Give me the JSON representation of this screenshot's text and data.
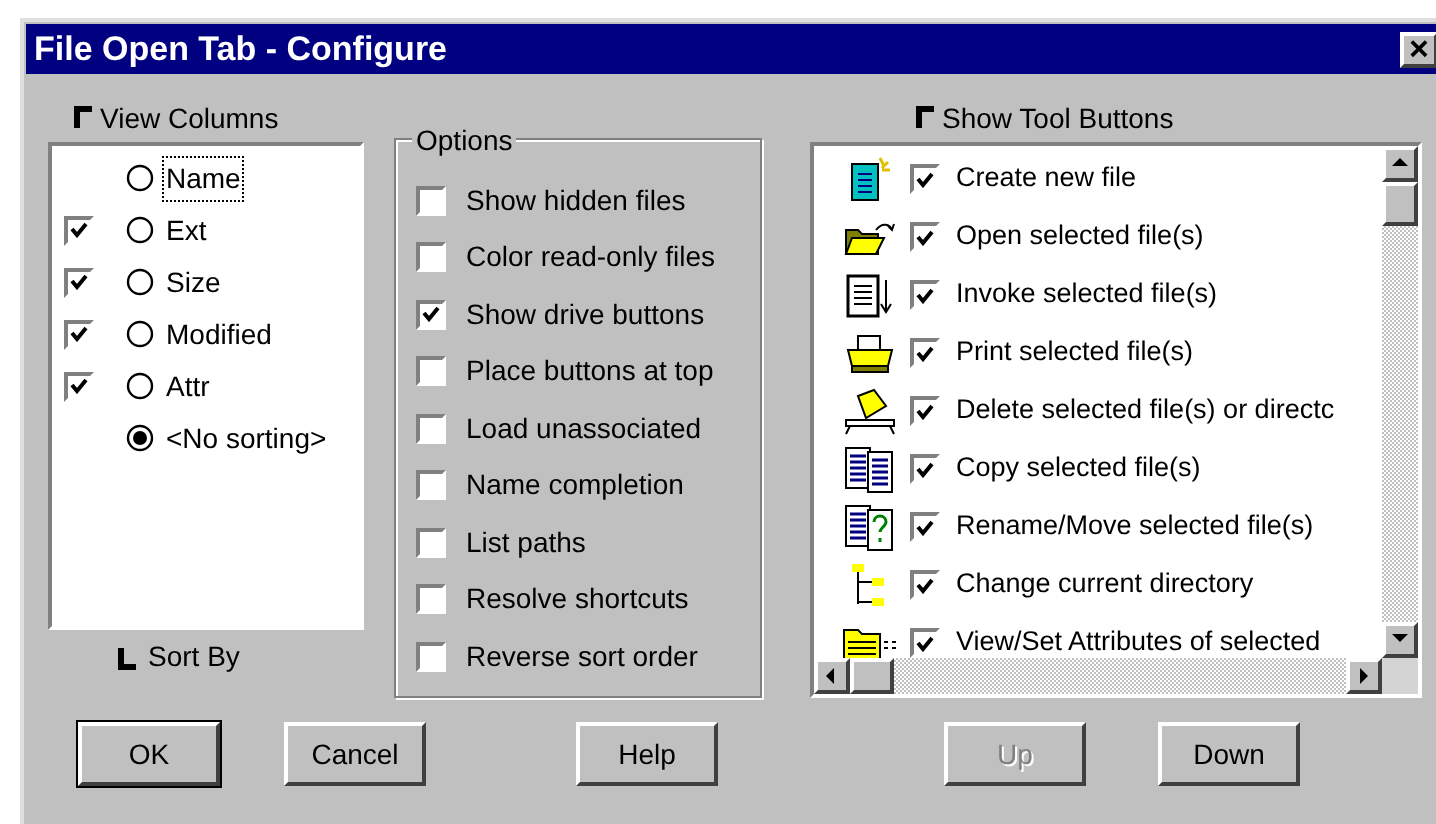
{
  "window": {
    "title": "File Open Tab - Configure",
    "close": "×"
  },
  "view_columns": {
    "label": "View Columns",
    "footer": "Sort By",
    "items": [
      {
        "label": "Name",
        "selected": false,
        "focused": true
      },
      {
        "label": "Ext",
        "checked": true,
        "selected": false,
        "focused": false
      },
      {
        "label": "Size",
        "checked": true,
        "selected": false,
        "focused": false
      },
      {
        "label": "Modified",
        "checked": true,
        "selected": false,
        "focused": false
      },
      {
        "label": "Attr",
        "checked": true,
        "selected": false,
        "focused": false
      },
      {
        "label": "<No sorting>",
        "selected": true,
        "focused": false
      }
    ]
  },
  "options": {
    "label": "Options",
    "items": [
      {
        "label": "Show hidden files",
        "checked": false
      },
      {
        "label": "Color read-only files",
        "checked": false
      },
      {
        "label": "Show drive buttons",
        "checked": true
      },
      {
        "label": "Place buttons at top",
        "checked": false
      },
      {
        "label": "Load unassociated",
        "checked": false
      },
      {
        "label": "Name completion",
        "checked": false
      },
      {
        "label": "List paths",
        "checked": false
      },
      {
        "label": "Resolve shortcuts",
        "checked": false
      },
      {
        "label": "Reverse sort order",
        "checked": false
      }
    ]
  },
  "tool_buttons": {
    "label": "Show Tool Buttons",
    "items": [
      {
        "label": "Create new file",
        "checked": true
      },
      {
        "label": "Open selected file(s)",
        "checked": true
      },
      {
        "label": "Invoke selected file(s)",
        "checked": true
      },
      {
        "label": "Print selected file(s)",
        "checked": true
      },
      {
        "label": "Delete selected file(s) or directc",
        "checked": true
      },
      {
        "label": "Copy selected file(s)",
        "checked": true
      },
      {
        "label": "Rename/Move selected file(s)",
        "checked": true
      },
      {
        "label": "Change current directory",
        "checked": true
      },
      {
        "label": "View/Set Attributes of selected",
        "checked": true
      }
    ]
  },
  "buttons": [
    {
      "label": "OK",
      "default": true,
      "disabled": false
    },
    {
      "label": "Cancel",
      "default": false,
      "disabled": false
    },
    {
      "label": "Help",
      "default": false,
      "disabled": false
    },
    {
      "label": "Up",
      "default": false,
      "disabled": true
    },
    {
      "label": "Down",
      "default": false,
      "disabled": false
    }
  ]
}
